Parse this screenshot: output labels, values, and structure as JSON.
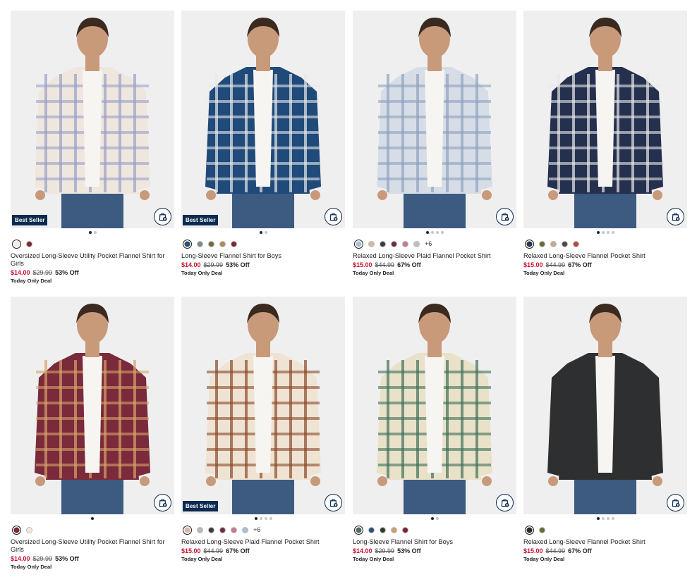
{
  "common": {
    "today_deal": "Today Only Deal",
    "best_seller": "Best Seller"
  },
  "products": [
    {
      "name": "Oversized Long-Sleeve Utility Pocket Flannel Shirt for Girls",
      "sale": "$14.00",
      "orig": "$29.99",
      "off": "53% Off",
      "swatches": [
        "#f3ede6",
        "#7a2a33"
      ],
      "more": "",
      "pager_count": 2,
      "pager_active": 0,
      "best_seller": true,
      "shirt_color": "#efe6de",
      "stripe_color": "#9aa0c8"
    },
    {
      "name": "Long-Sleeve Flannel Shirt for Boys",
      "sale": "$14.00",
      "orig": "$29.99",
      "off": "53% Off",
      "swatches": [
        "#2b4f78",
        "#7e8a8f",
        "#6f6b3d",
        "#b08a55",
        "#7a2533"
      ],
      "more": "",
      "pager_count": 2,
      "pager_active": 0,
      "best_seller": true,
      "shirt_color": "#1f4a7a",
      "stripe_color": "#e8e8e8"
    },
    {
      "name": "Relaxed Long-Sleeve Plaid Flannel Pocket Shirt",
      "sale": "$15.00",
      "orig": "$44.99",
      "off": "67% Off",
      "swatches": [
        "#a9c0d6",
        "#d9b7a6",
        "#3a3a3a",
        "#6f2b3a",
        "#c77a8a",
        "#b8c0c7"
      ],
      "more": "+6",
      "pager_count": 4,
      "pager_active": 0,
      "best_seller": false,
      "shirt_color": "#d7dde6",
      "stripe_color": "#8ea2bf"
    },
    {
      "name": "Relaxed Long-Sleeve Flannel Pocket Shirt",
      "sale": "$15.00",
      "orig": "$44.99",
      "off": "67% Off",
      "swatches": [
        "#2a3550",
        "#6a6a3a",
        "#c9a98a",
        "#4a4a4a",
        "#b34a4a"
      ],
      "more": "",
      "pager_count": 4,
      "pager_active": 0,
      "best_seller": false,
      "shirt_color": "#25304f",
      "stripe_color": "#e8e8e8"
    },
    {
      "name": "Oversized Long-Sleeve Utility Pocket Flannel Shirt for Girls",
      "sale": "$14.00",
      "orig": "$29.99",
      "off": "53% Off",
      "swatches": [
        "#7a2a33",
        "#f0ebe4"
      ],
      "more": "",
      "pager_count": 1,
      "pager_active": 0,
      "best_seller": false,
      "shirt_color": "#7a2a3a",
      "stripe_color": "#d9a36a"
    },
    {
      "name": "Relaxed Long-Sleeve Plaid Flannel Pocket Shirt",
      "sale": "$15.00",
      "orig": "$44.99",
      "off": "67% Off",
      "swatches": [
        "#d9b7a6",
        "#b8b8b8",
        "#3a3a3a",
        "#6f2b3a",
        "#c77a8a",
        "#a9c0d6"
      ],
      "more": "+6",
      "pager_count": 4,
      "pager_active": 0,
      "best_seller": true,
      "shirt_color": "#efe3d3",
      "stripe_color": "#8a4a2a"
    },
    {
      "name": "Long-Sleeve Flannel Shirt for Boys",
      "sale": "$14.00",
      "orig": "$29.99",
      "off": "53% Off",
      "swatches": [
        "#4f6f5a",
        "#2b4f78",
        "#2f3f2f",
        "#c9a06a",
        "#7a2533"
      ],
      "more": "",
      "pager_count": 2,
      "pager_active": 0,
      "best_seller": false,
      "shirt_color": "#e9e2c9",
      "stripe_color": "#3e6f58"
    },
    {
      "name": "Relaxed Long-Sleeve Flannel Pocket Shirt",
      "sale": "$15.00",
      "orig": "$44.99",
      "off": "67% Off",
      "swatches": [
        "#2b2b2b",
        "#6b6b3a"
      ],
      "more": "",
      "pager_count": 4,
      "pager_active": 0,
      "best_seller": false,
      "shirt_color": "#2e2f31",
      "stripe_color": "#2e2f31"
    }
  ]
}
